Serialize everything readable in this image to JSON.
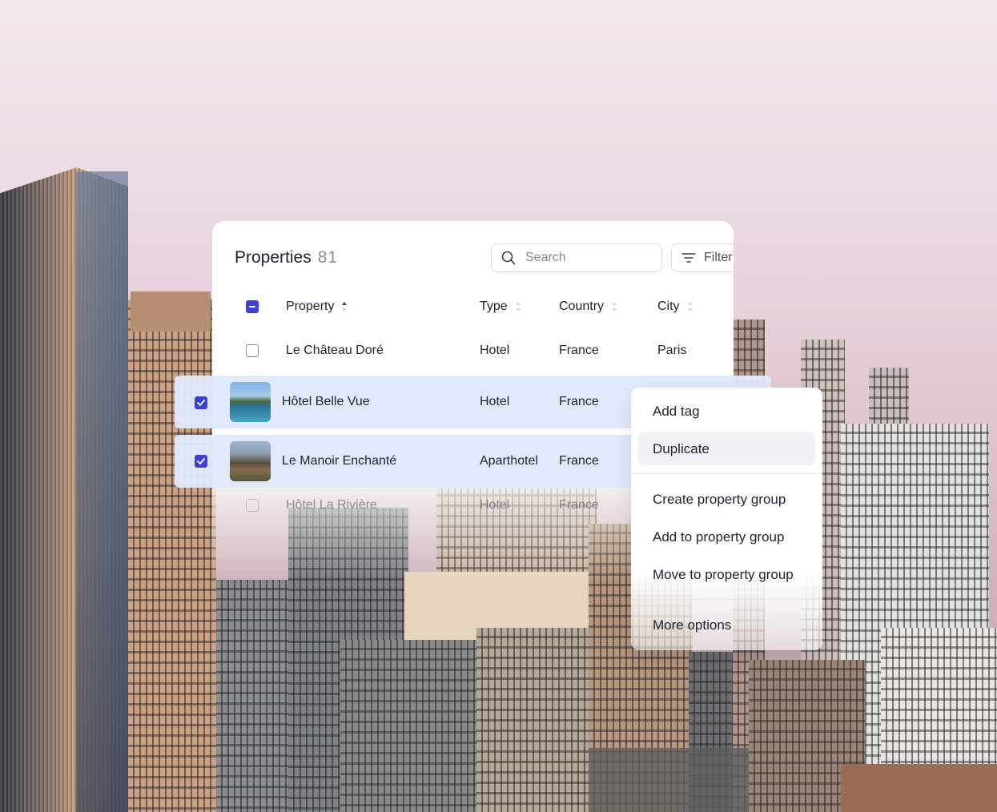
{
  "table": {
    "title": "Properties",
    "count": "81",
    "search_placeholder": "Search",
    "filter_label": "Filter",
    "columns": [
      "Property",
      "Type",
      "Country",
      "City"
    ],
    "rows": [
      {
        "property": "Le Château Doré",
        "type": "Hotel",
        "country": "France",
        "city": "Paris",
        "selected": false
      },
      {
        "property": "Hôtel Belle Vue",
        "type": "Hotel",
        "country": "France",
        "city": "",
        "selected": true
      },
      {
        "property": "Le Manoir Enchanté",
        "type": "Aparthotel",
        "country": "France",
        "city": "",
        "selected": true
      },
      {
        "property": "Hôtel La Rivière",
        "type": "Hotel",
        "country": "France",
        "city": "",
        "selected": false
      }
    ]
  },
  "menu": {
    "items": [
      "Add tag",
      "Duplicate",
      "Create property group",
      "Add to property group",
      "Move to property group",
      "More options"
    ]
  },
  "colors": {
    "accent": "#3d3fd6",
    "selected_row": "#e2e8fc",
    "menu_highlight": "#f1f1f5"
  }
}
